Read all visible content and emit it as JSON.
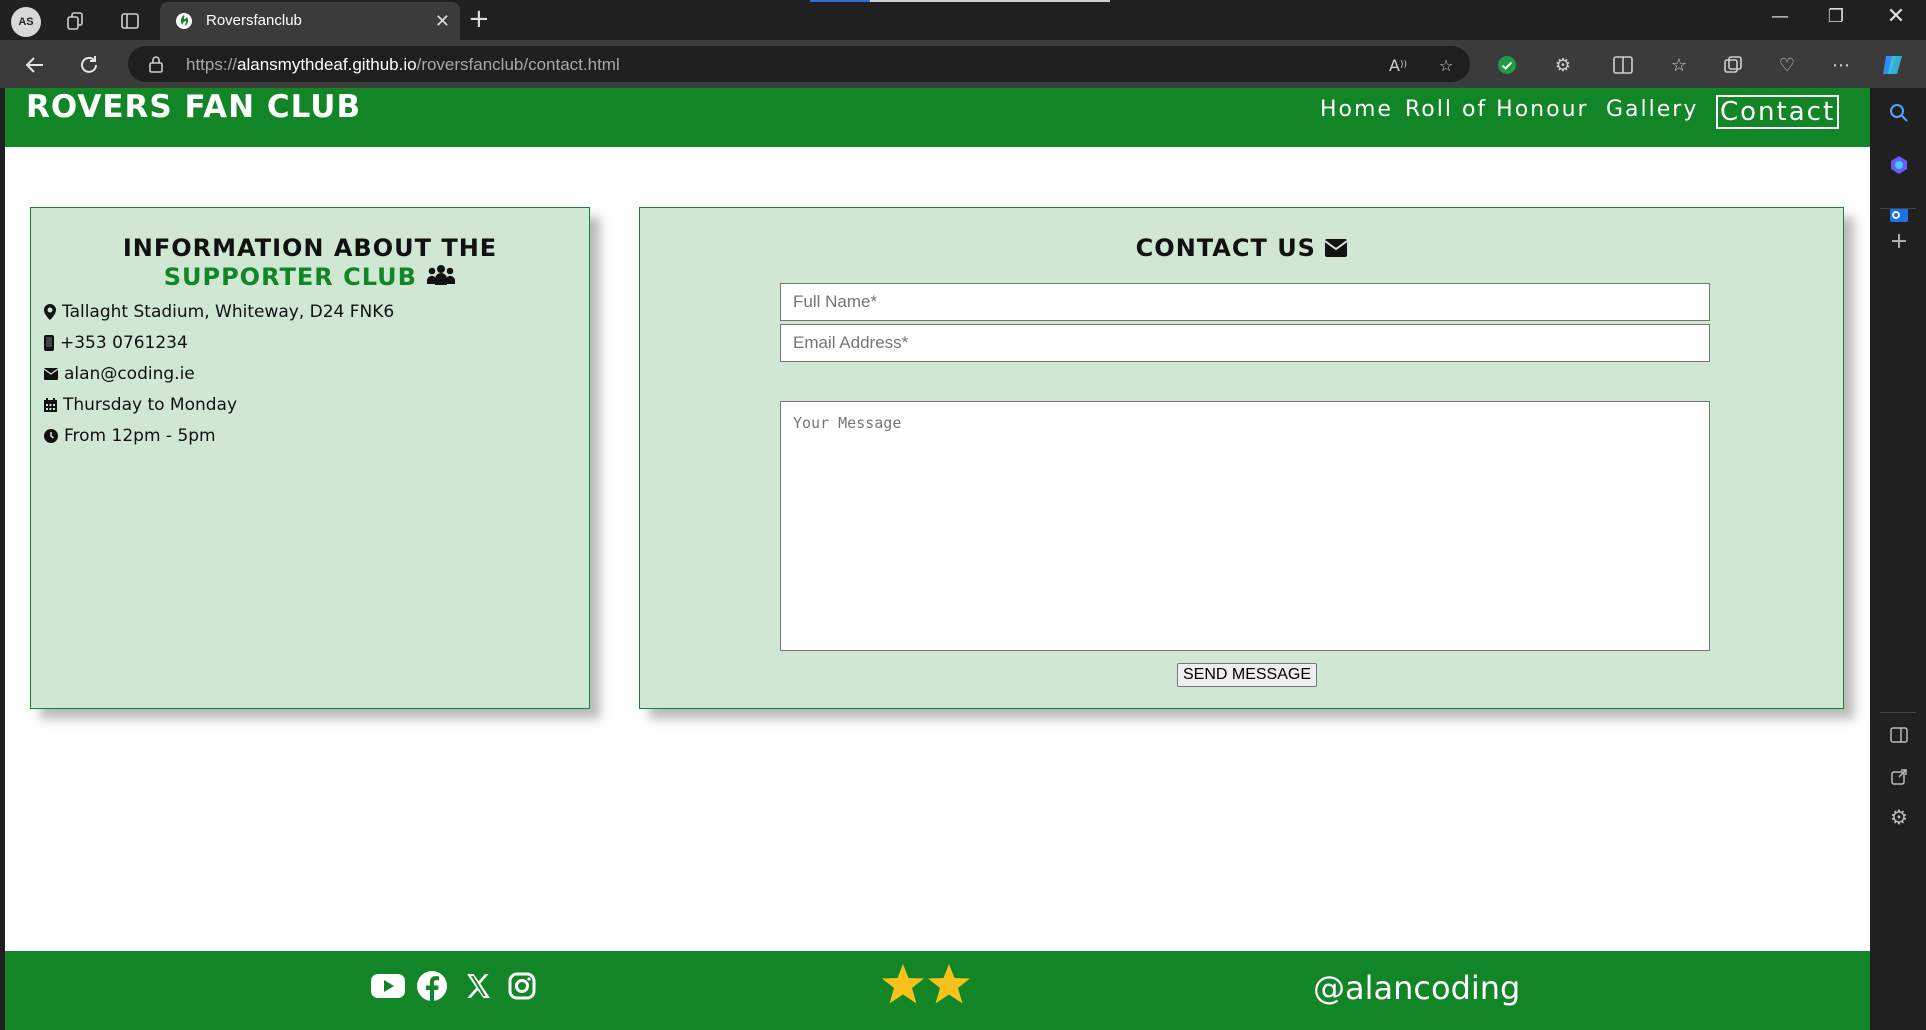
{
  "browser": {
    "profile_initials": "AS",
    "tab_title": "Roversfanclub",
    "url_prefix": "https://",
    "url_host": "alansmythdeaf.github.io",
    "url_path": "/roversfanclub/contact.html"
  },
  "site": {
    "logo": "ROVERS FAN CLUB",
    "nav": [
      "Home",
      "Roll of Honour",
      "Gallery",
      "Contact"
    ],
    "active_nav": "Contact",
    "brand_color": "#128526"
  },
  "info": {
    "title_line1": "INFORMATION ABOUT THE",
    "title_line2": "SUPPORTER CLUB",
    "address": "Tallaght Stadium, Whiteway, D24 FNK6",
    "phone": "+353 0761234",
    "email": "alan@coding.ie",
    "days": "Thursday to Monday",
    "hours": "From 12pm - 5pm"
  },
  "contact": {
    "title": "CONTACT US",
    "name_placeholder": "Full Name*",
    "email_placeholder": "Email Address*",
    "message_placeholder": "Your Message",
    "send_label": "SEND MESSAGE"
  },
  "footer": {
    "social_icons": [
      "youtube-icon",
      "facebook-icon",
      "x-icon",
      "instagram-icon"
    ],
    "handle": "@alancoding"
  }
}
